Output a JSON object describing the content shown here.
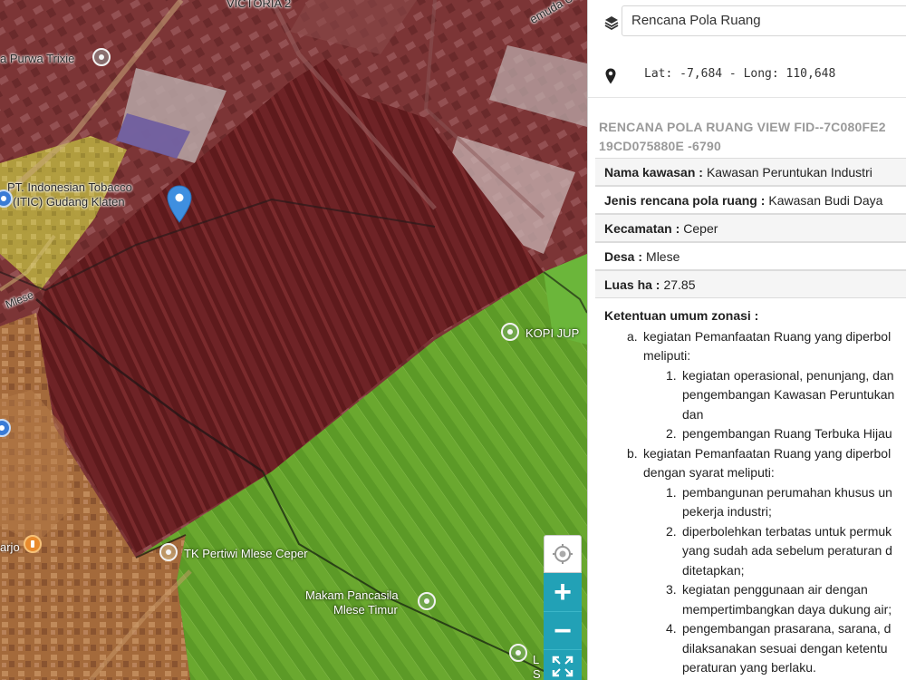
{
  "map": {
    "labels": {
      "victoria": "VICTORIA 2",
      "muda_utara": "emuda Utara",
      "purwa_trixie": "a Purwa Trixie",
      "indonesian_tobacco_1": "PT. Indonesian Tobacco",
      "indonesian_tobacco_2": "(ITIC) Gudang Klaten",
      "mlese_road": "Mlese",
      "kopi": "KOPI JUP",
      "tk_pertiwi": "TK Pertiwi Mlese Ceper",
      "makam_1": "Makam Pancasila",
      "makam_2": "Mlese Timur",
      "arjo": "arjo",
      "bottom_l": "L",
      "bottom_s": "S"
    },
    "zone_colors": {
      "industri": "#6e2020",
      "permukiman": "#a06a3a",
      "pertanian": "#5f9e2a",
      "kuning": "#b8a23a"
    },
    "controls": {
      "locate": "locate-icon",
      "zoom_in": "+",
      "zoom_out": "−",
      "fullscreen": "fullscreen-icon"
    }
  },
  "panel": {
    "layer_select": "Rencana Pola Ruang",
    "coords": "Lat: -7,684 - Long: 110,648",
    "fid_title": "RENCANA POLA RUANG VIEW FID--7C080FE2 19CD075880E -6790",
    "attributes": [
      {
        "label": "Nama kawasan :",
        "value": "Kawasan Peruntukan Industri"
      },
      {
        "label": "Jenis rencana pola ruang :",
        "value": "Kawasan Budi Daya"
      },
      {
        "label": "Kecamatan :",
        "value": "Ceper"
      },
      {
        "label": "Desa :",
        "value": "Mlese"
      },
      {
        "label": "Luas ha :",
        "value": "27.85"
      }
    ],
    "ketentuan": {
      "title": "Ketentuan umum zonasi :",
      "a_line1": "kegiatan Pemanfaatan Ruang yang diperbol",
      "a_line2": "meliputi:",
      "a1_line1": "kegiatan operasional, penunjang, dan",
      "a1_line2": "pengembangan Kawasan Peruntukan",
      "a1_line3": "dan",
      "a2_line1": "pengembangan Ruang Terbuka Hijau",
      "b_line1": "kegiatan Pemanfaatan Ruang yang diperbol",
      "b_line2": "dengan syarat meliputi:",
      "b1_line1": "pembangunan perumahan khusus un",
      "b1_line2": "pekerja industri;",
      "b2_line1": "diperbolehkan terbatas untuk permuk",
      "b2_line2": "yang sudah ada sebelum peraturan d",
      "b2_line3": "ditetapkan;",
      "b3_line1": "kegiatan penggunaan air dengan",
      "b3_line2": "mempertimbangkan daya dukung air;",
      "b4_line1": "pengembangan prasarana, sarana, d",
      "b4_line2": "dilaksanakan sesuai dengan ketentu",
      "b4_line3": "peraturan yang berlaku.",
      "markers": {
        "a": "a.",
        "b": "b.",
        "n1": "1.",
        "n2": "2.",
        "n3": "3.",
        "n4": "4."
      }
    }
  }
}
